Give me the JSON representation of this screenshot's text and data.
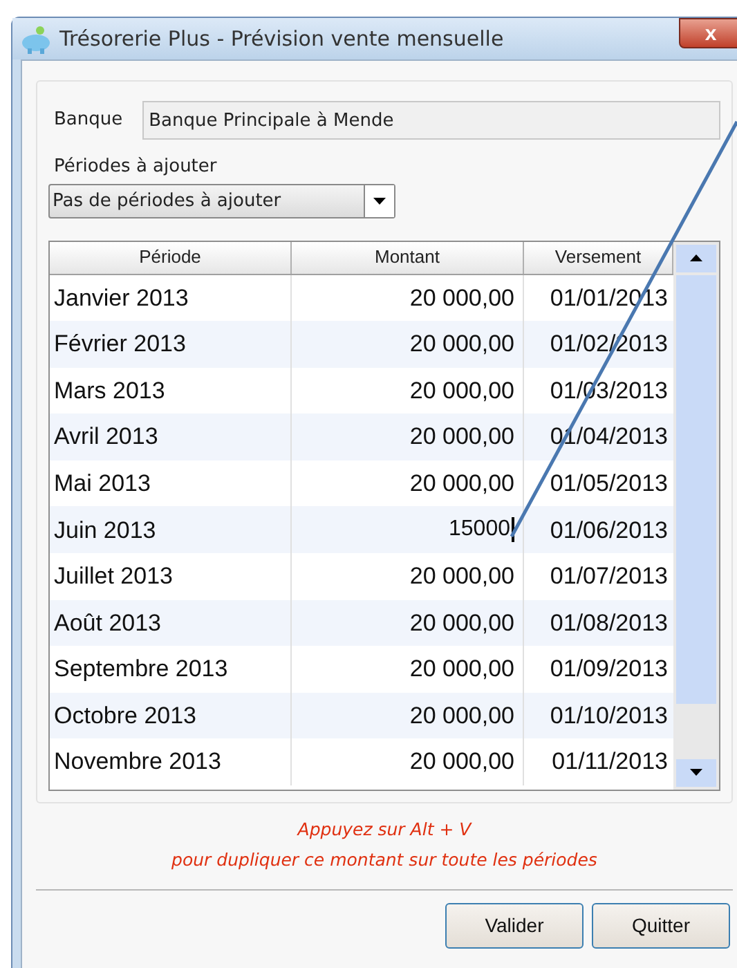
{
  "window": {
    "title": "Trésorerie Plus - Prévision vente mensuelle",
    "close": "x"
  },
  "bank": {
    "label": "Banque",
    "value": "Banque Principale à Mende"
  },
  "periods": {
    "label": "Périodes à ajouter",
    "value": "Pas de périodes à ajouter"
  },
  "table": {
    "columns": [
      "Période",
      "Montant",
      "Versement"
    ],
    "rows": [
      {
        "period": "Janvier 2013",
        "amount": "20 000,00",
        "payment": "01/01/2013",
        "editing": false
      },
      {
        "period": "Février 2013",
        "amount": "20 000,00",
        "payment": "01/02/2013",
        "editing": false
      },
      {
        "period": "Mars 2013",
        "amount": "20 000,00",
        "payment": "01/03/2013",
        "editing": false
      },
      {
        "period": "Avril 2013",
        "amount": "20 000,00",
        "payment": "01/04/2013",
        "editing": false
      },
      {
        "period": "Mai 2013",
        "amount": "20 000,00",
        "payment": "01/05/2013",
        "editing": false
      },
      {
        "period": "Juin 2013",
        "amount": "15000",
        "payment": "01/06/2013",
        "editing": true
      },
      {
        "period": "Juillet 2013",
        "amount": "20 000,00",
        "payment": "01/07/2013",
        "editing": false
      },
      {
        "period": "Août 2013",
        "amount": "20 000,00",
        "payment": "01/08/2013",
        "editing": false
      },
      {
        "period": "Septembre 2013",
        "amount": "20 000,00",
        "payment": "01/09/2013",
        "editing": false
      },
      {
        "period": "Octobre 2013",
        "amount": "20 000,00",
        "payment": "01/10/2013",
        "editing": false
      },
      {
        "period": "Novembre 2013",
        "amount": "20 000,00",
        "payment": "01/11/2013",
        "editing": false
      }
    ]
  },
  "hint": [
    "Appuyez sur Alt + V",
    "pour dupliquer ce montant sur toute les périodes"
  ],
  "buttons": [
    "Valider",
    "Quitter"
  ]
}
